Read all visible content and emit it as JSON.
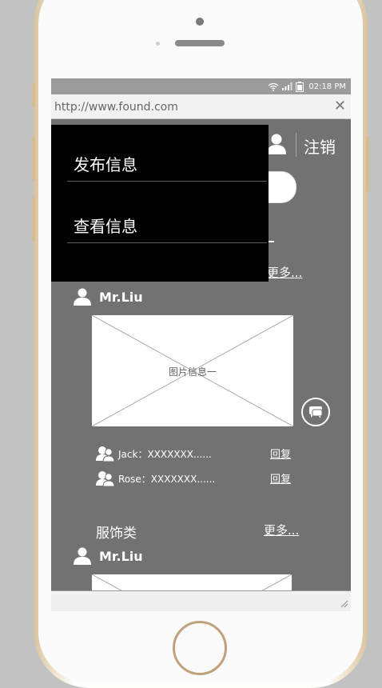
{
  "status_bar": {
    "time": "02:18 PM"
  },
  "url_bar": {
    "url": "http://www.found.com",
    "close_glyph": "✕"
  },
  "header": {
    "logout_label": "注销"
  },
  "dropdown": {
    "items": [
      {
        "label": "发布信息"
      },
      {
        "label": "查看信息"
      }
    ]
  },
  "section1": {
    "more_label": "更多...",
    "post": {
      "author": "Mr.Liu",
      "image_caption": "图片信息一",
      "comments": [
        {
          "text": "Jack：XXXXXXX......",
          "reply": "回复"
        },
        {
          "text": "Rose：XXXXXXX......",
          "reply": "回复"
        }
      ]
    }
  },
  "section2": {
    "title": "服饰类",
    "more_label": "更多...",
    "post": {
      "author": "Mr.Liu"
    }
  },
  "icons": {
    "user": "user-icon",
    "chat": "chat-icon",
    "comment_users": "users-icon",
    "wifi": "wifi-icon",
    "signal": "signal-icon",
    "battery": "battery-icon"
  },
  "colors": {
    "screen_bg": "#727272",
    "menu_bg": "#000000",
    "status_bar_bg": "#9b9b9b"
  }
}
